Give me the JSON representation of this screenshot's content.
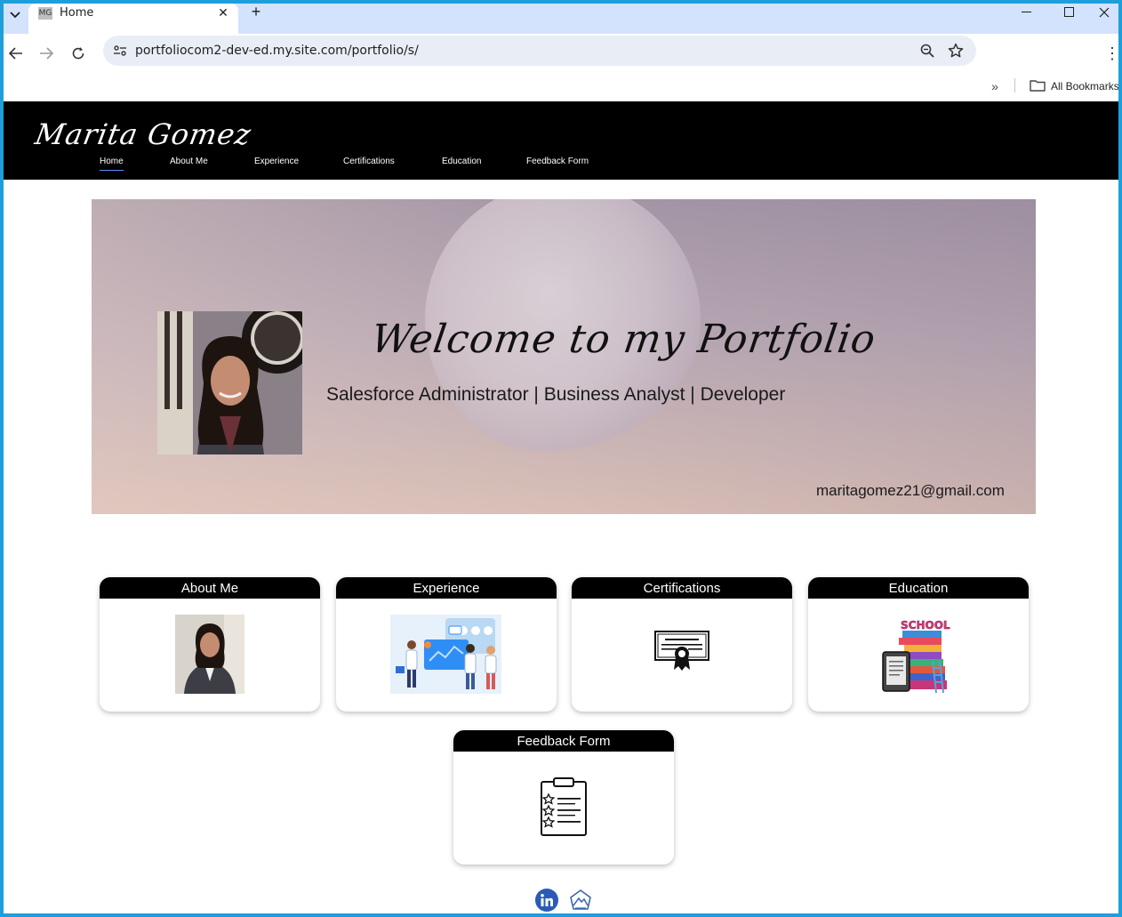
{
  "browser": {
    "tab_favicon": "MG",
    "tab_title": "Home",
    "url": "portfoliocom2-dev-ed.my.site.com/portfolio/s/",
    "bookmarks_label": "All Bookmarks"
  },
  "site": {
    "logo": "Marita Gomez",
    "nav": [
      "Home",
      "About Me",
      "Experience",
      "Certifications",
      "Education",
      "Feedback Form"
    ],
    "active_nav": "Home"
  },
  "banner": {
    "welcome": "Welcome to my Portfolio",
    "subtitle": "Salesforce Administrator | Business Analyst | Developer",
    "email": "maritagomez21@gmail.com"
  },
  "cards": [
    {
      "title": "About Me",
      "icon": "portrait-photo"
    },
    {
      "title": "Experience",
      "icon": "team-illustration"
    },
    {
      "title": "Certifications",
      "icon": "certificate-icon"
    },
    {
      "title": "Education",
      "icon": "school-books-icon"
    },
    {
      "title": "Feedback Form",
      "icon": "clipboard-checklist-icon"
    }
  ],
  "footer": {
    "social": [
      "linkedin-icon",
      "trailhead-icon"
    ]
  },
  "colors": {
    "header_bg": "#000000",
    "active_underline": "#5b8ff9",
    "linkedin": "#2b5bb5"
  }
}
